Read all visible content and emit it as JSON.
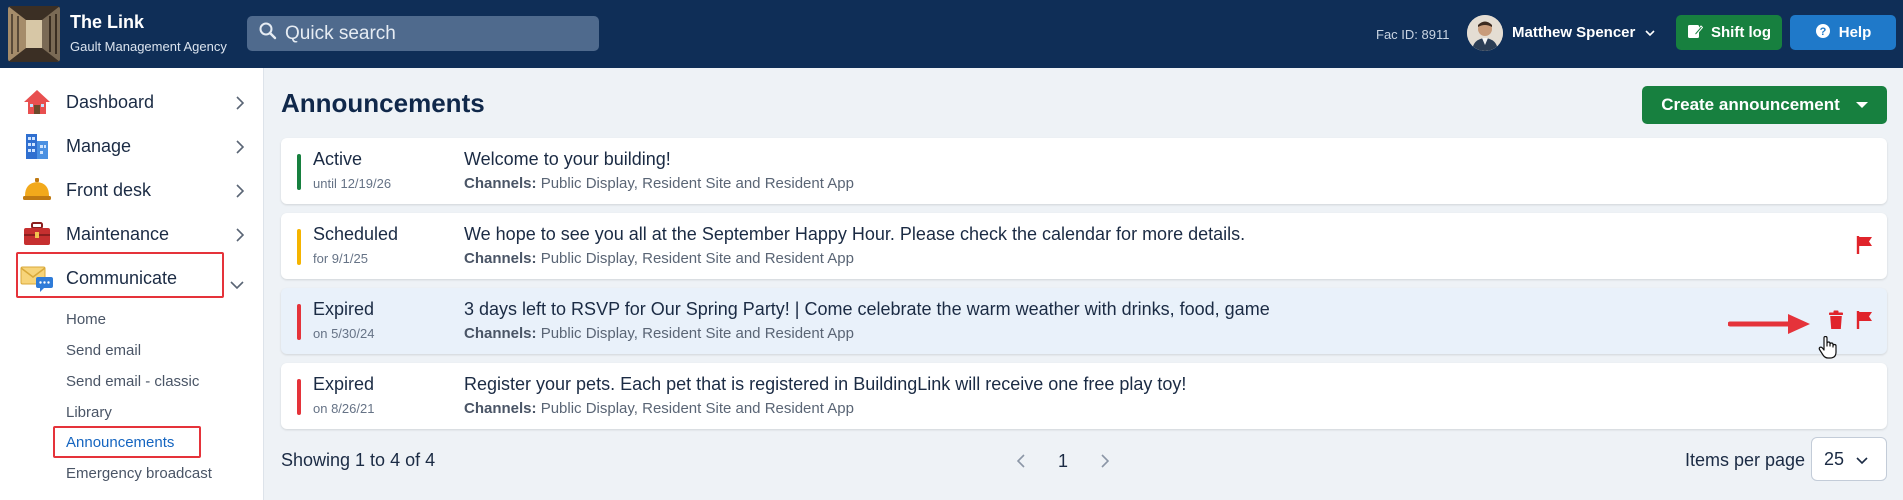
{
  "header": {
    "app_title": "The Link",
    "app_subtitle": "Gault Management Agency",
    "search_placeholder": "Quick search",
    "fac_id": "Fac ID: 8911",
    "user_name": "Matthew Spencer",
    "shift_log_label": "Shift log",
    "help_label": "Help"
  },
  "sidebar": {
    "items": [
      {
        "label": "Dashboard",
        "icon": "house-icon"
      },
      {
        "label": "Manage",
        "icon": "building-icon"
      },
      {
        "label": "Front desk",
        "icon": "bell-icon"
      },
      {
        "label": "Maintenance",
        "icon": "toolbox-icon"
      },
      {
        "label": "Communicate",
        "icon": "envelope-chat-icon"
      }
    ],
    "sub_items": [
      "Home",
      "Send email",
      "Send email - classic",
      "Library",
      "Announcements",
      "Emergency broadcast"
    ]
  },
  "main": {
    "title": "Announcements",
    "create_label": "Create announcement",
    "announcements": [
      {
        "status": "Active",
        "status_sub": "until 12/19/26",
        "title": "Welcome to your building!",
        "channels_label": "Channels:",
        "channels": "Public Display, Resident Site and Resident App",
        "color": "#17803f"
      },
      {
        "status": "Scheduled",
        "status_sub": "for 9/1/25",
        "title": "We hope to see you all at the September Happy Hour. Please check the calendar for more details.",
        "channels_label": "Channels:",
        "channels": "Public Display, Resident Site and Resident App",
        "color": "#f5b400"
      },
      {
        "status": "Expired",
        "status_sub": "on 5/30/24",
        "title": "3 days left to RSVP for Our Spring Party! | Come celebrate the warm weather with drinks, food, game",
        "channels_label": "Channels:",
        "channels": "Public Display, Resident Site and Resident App",
        "color": "#e5333a"
      },
      {
        "status": "Expired",
        "status_sub": "on 8/26/21",
        "title": "Register your pets. Each pet that is registered in BuildingLink will receive one free play toy!",
        "channels_label": "Channels:",
        "channels": "Public Display, Resident Site and Resident App",
        "color": "#e5333a"
      }
    ],
    "showing_text": "Showing 1 to 4 of 4",
    "current_page": "1",
    "items_per_page_label": "Items per page",
    "items_per_page_value": "25"
  },
  "colors": {
    "topbar": "#0f2e57",
    "accent_green": "#17803f",
    "accent_blue": "#1f79c9",
    "alert_red": "#e5333a"
  }
}
